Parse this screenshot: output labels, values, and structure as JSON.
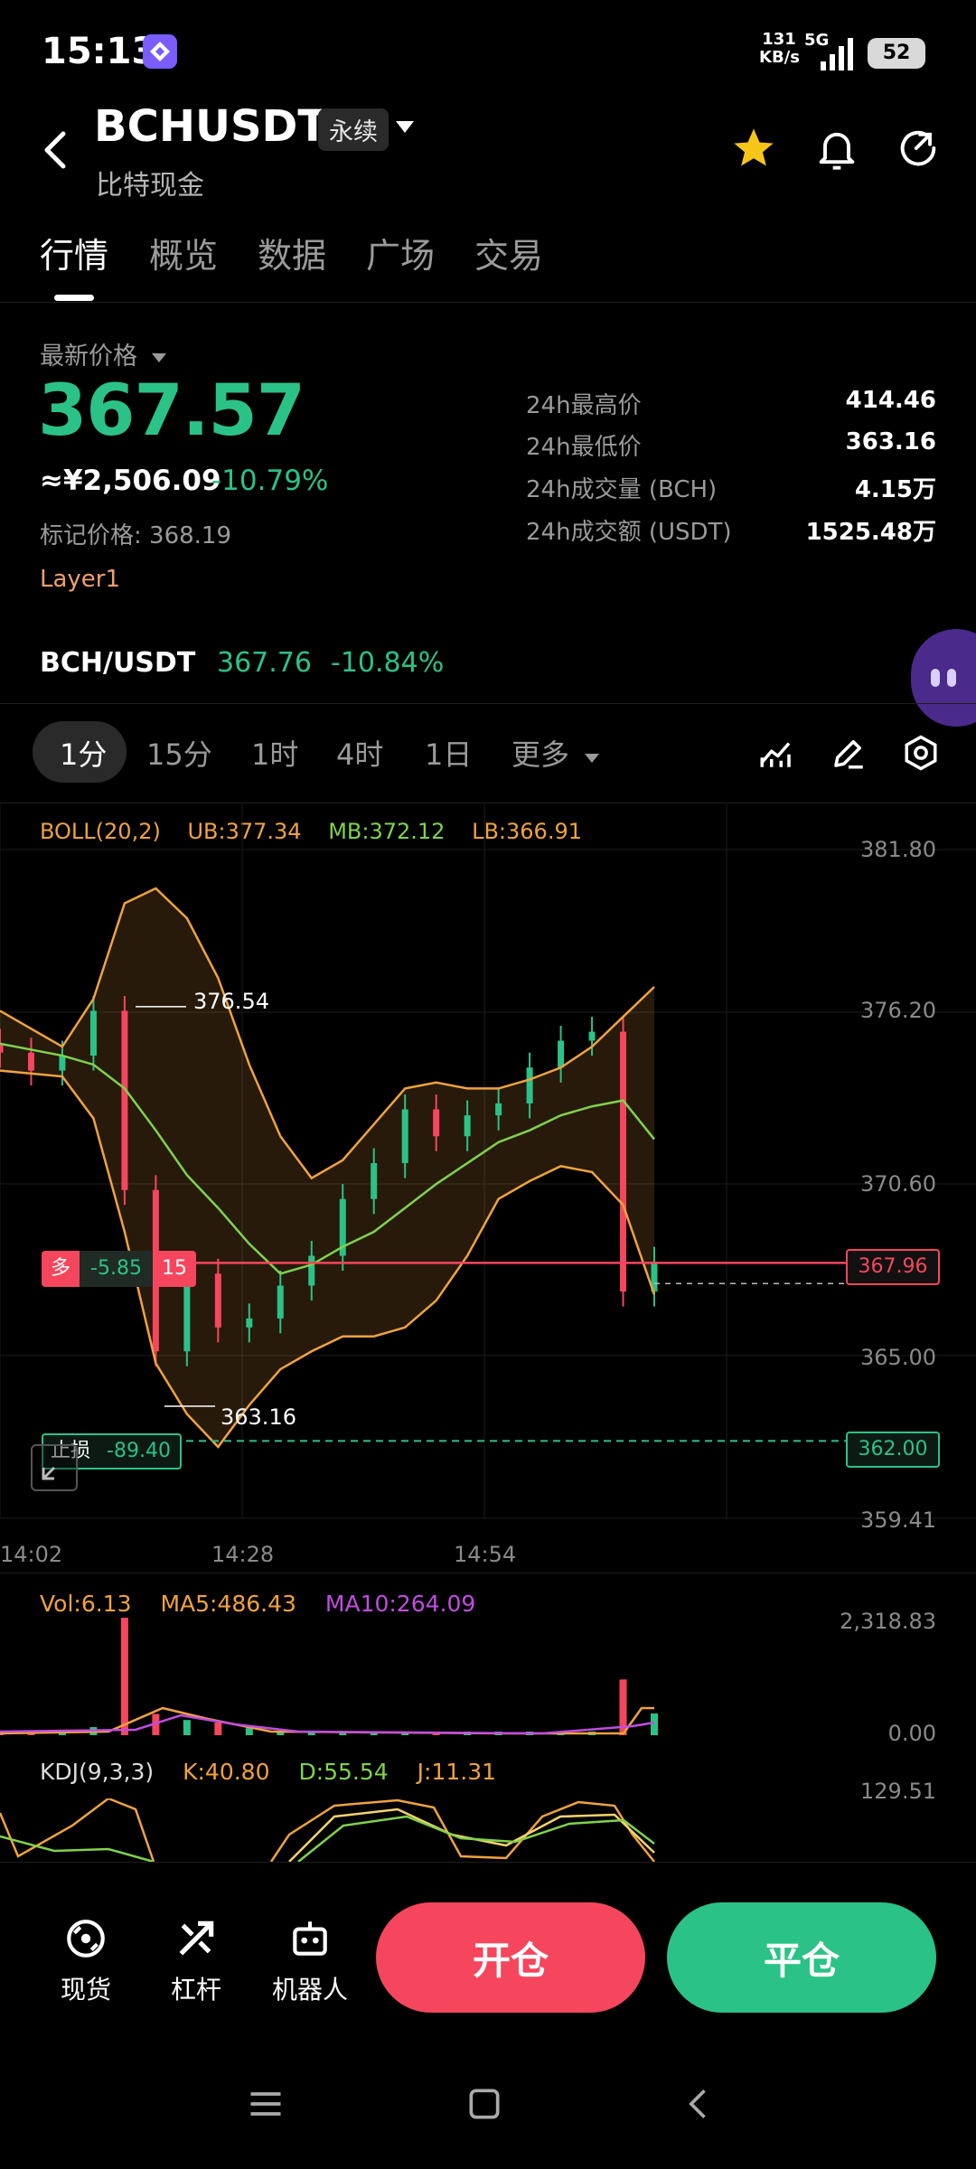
{
  "status_bar": {
    "time": "15:13",
    "net_speed_value": "131",
    "net_speed_unit": "KB/s",
    "network": "5G",
    "battery": "52"
  },
  "header": {
    "symbol": "BCHUSDT",
    "contract_type": "永续",
    "subtitle": "比特现金"
  },
  "tabs": [
    "行情",
    "概览",
    "数据",
    "广场",
    "交易"
  ],
  "price": {
    "label": "最新价格",
    "last": "367.57",
    "cny": "≈¥2,506.09",
    "change": "-10.79%",
    "mark_price": "标记价格: 368.19",
    "tag": "Layer1"
  },
  "stats": [
    {
      "label": "24h最高价",
      "value": "414.46"
    },
    {
      "label": "24h最低价",
      "value": "363.16"
    },
    {
      "label": "24h成交量 (BCH)",
      "value": "4.15万"
    },
    {
      "label": "24h成交额 (USDT)",
      "value": "1525.48万"
    }
  ],
  "spot": {
    "pair": "BCH/USDT",
    "price": "367.76",
    "change": "-10.84%"
  },
  "timeframes": [
    "1分",
    "15分",
    "1时",
    "4时",
    "1日",
    "更多"
  ],
  "boll": {
    "label": "BOLL(20,2)",
    "ub": "UB:377.34",
    "mb": "MB:372.12",
    "lb": "LB:366.91"
  },
  "price_axis": [
    "381.80",
    "376.20",
    "370.60",
    "365.00",
    "359.41"
  ],
  "time_axis": [
    "14:02",
    "14:28",
    "14:54"
  ],
  "annotations": {
    "high": "376.54",
    "low": "363.16"
  },
  "position": {
    "side": "多",
    "pnl": "-5.85",
    "leverage": "15",
    "price_tag": "367.96"
  },
  "stop_loss": {
    "label": "止损",
    "pnl": "-89.40",
    "price_tag": "362.00"
  },
  "volume": {
    "label": "Vol:6.13",
    "ma5": "MA5:486.43",
    "ma10": "MA10:264.09",
    "max": "2,318.83",
    "min": "0.00"
  },
  "kdj": {
    "label": "KDJ(9,3,3)",
    "k": "K:40.80",
    "d": "D:55.54",
    "j": "J:11.31",
    "max": "129.51"
  },
  "bottom_tools": [
    "现货",
    "杠杆",
    "机器人"
  ],
  "actions": {
    "open": "开仓",
    "close": "平仓"
  },
  "colors": {
    "up": "#2bc287",
    "down": "#f6465d",
    "boll_ub": "#f0a33d",
    "boll_mb": "#7fd34c",
    "star": "#f5c518"
  },
  "chart_data": {
    "type": "candlestick",
    "title": "",
    "ylim": [
      359.41,
      381.8
    ],
    "x": [
      "14:02",
      "14:28",
      "14:54"
    ],
    "series": [
      {
        "name": "UB",
        "values": [
          376.4,
          375.8,
          375.2,
          376.8,
          380.0,
          380.5,
          379.5,
          377.5,
          374.6,
          372.2,
          370.8,
          371.4,
          372.6,
          373.8,
          374.0,
          373.8,
          373.8,
          374.1,
          374.5,
          375.2,
          376.2,
          377.2
        ]
      },
      {
        "name": "MB",
        "values": [
          375.3,
          375.1,
          374.9,
          374.6,
          373.8,
          372.4,
          370.9,
          369.8,
          368.6,
          367.6,
          367.9,
          368.5,
          369.0,
          369.8,
          370.6,
          371.3,
          372.0,
          372.4,
          372.9,
          373.2,
          373.4,
          372.1
        ]
      },
      {
        "name": "LB",
        "values": [
          374.4,
          374.3,
          374.2,
          372.8,
          369.0,
          364.6,
          362.9,
          361.8,
          363.2,
          364.4,
          365.0,
          365.5,
          365.5,
          365.8,
          366.7,
          368.2,
          370.1,
          370.7,
          371.2,
          371.0,
          369.9,
          366.9
        ]
      },
      {
        "name": "close",
        "values": [
          375.0,
          374.4,
          374.9,
          376.4,
          370.4,
          365.0,
          367.6,
          365.8,
          366.1,
          367.2,
          368.2,
          370.1,
          371.3,
          373.1,
          372.2,
          372.9,
          373.3,
          374.5,
          375.4,
          375.7,
          367.0,
          368.0
        ]
      }
    ],
    "volume": [
      40,
      60,
      50,
      160,
      2318,
      420,
      300,
      250,
      140,
      90,
      60,
      70,
      60,
      55,
      45,
      40,
      35,
      50,
      60,
      70,
      1100,
      430
    ],
    "reference_lines": [
      {
        "name": "position",
        "value": 367.96
      },
      {
        "name": "stop_loss",
        "value": 362.0
      },
      {
        "name": "last",
        "value": 367.57
      }
    ]
  }
}
